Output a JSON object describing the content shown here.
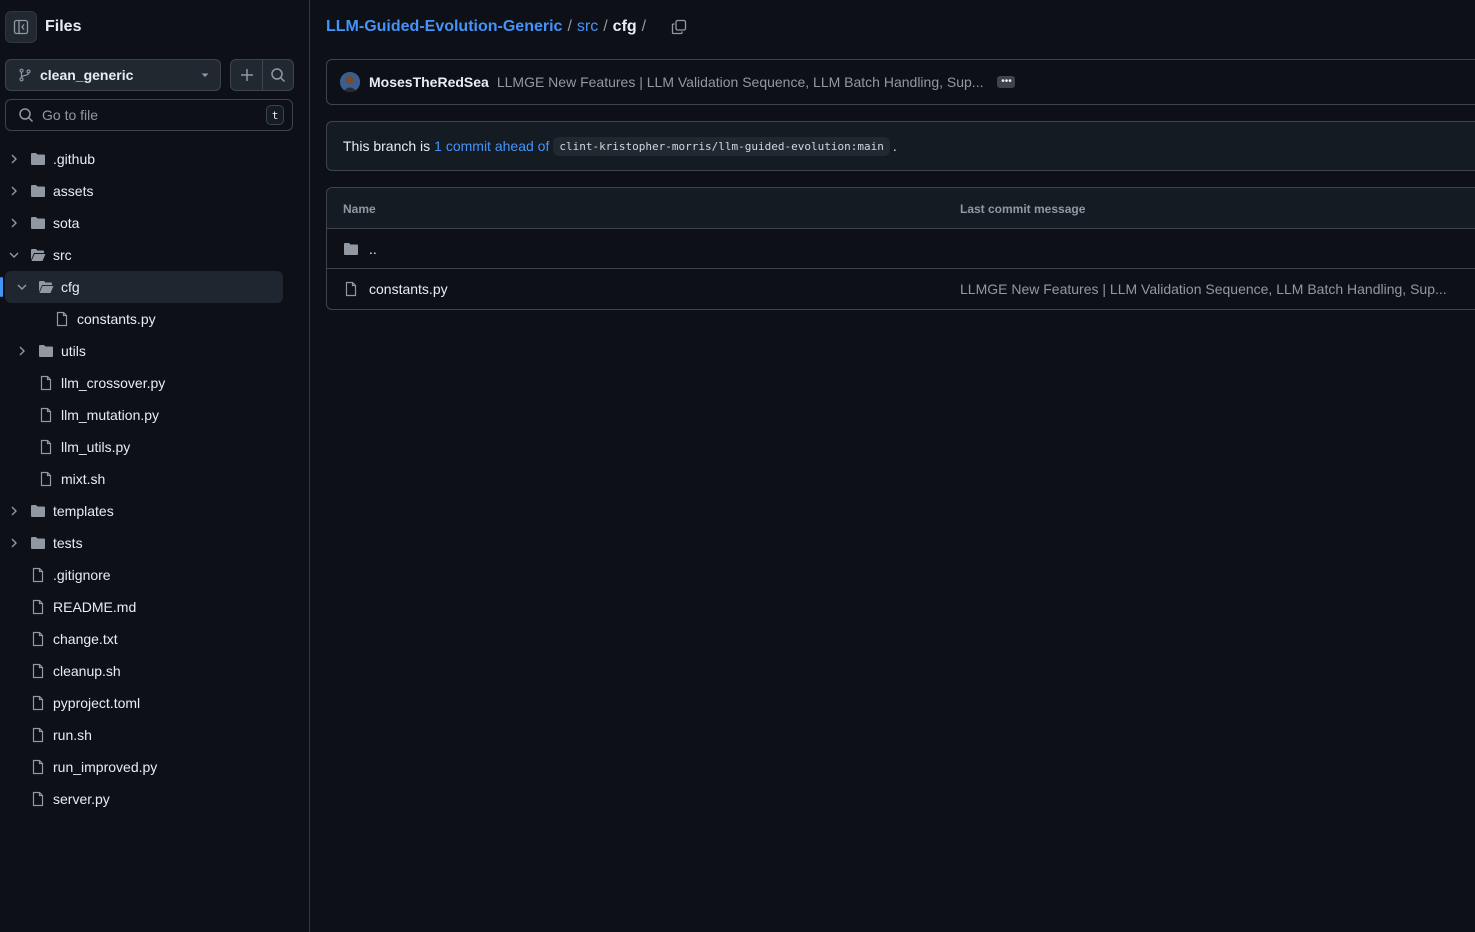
{
  "sidebar": {
    "title": "Files",
    "branch": "clean_generic",
    "search_placeholder": "Go to file",
    "search_shortcut": "t",
    "tree": [
      {
        "label": ".github",
        "type": "folder",
        "depth": 0,
        "expanded": false
      },
      {
        "label": "assets",
        "type": "folder",
        "depth": 0,
        "expanded": false
      },
      {
        "label": "sota",
        "type": "folder",
        "depth": 0,
        "expanded": false
      },
      {
        "label": "src",
        "type": "folder-open",
        "depth": 0,
        "expanded": true
      },
      {
        "label": "cfg",
        "type": "folder-open",
        "depth": 1,
        "expanded": true,
        "selected": true
      },
      {
        "label": "constants.py",
        "type": "file",
        "depth": 2
      },
      {
        "label": "utils",
        "type": "folder",
        "depth": 1,
        "expanded": false
      },
      {
        "label": "llm_crossover.py",
        "type": "file",
        "depth": 1
      },
      {
        "label": "llm_mutation.py",
        "type": "file",
        "depth": 1
      },
      {
        "label": "llm_utils.py",
        "type": "file",
        "depth": 1
      },
      {
        "label": "mixt.sh",
        "type": "file",
        "depth": 1
      },
      {
        "label": "templates",
        "type": "folder",
        "depth": 0,
        "expanded": false
      },
      {
        "label": "tests",
        "type": "folder",
        "depth": 0,
        "expanded": false
      },
      {
        "label": ".gitignore",
        "type": "file",
        "depth": 0
      },
      {
        "label": "README.md",
        "type": "file",
        "depth": 0
      },
      {
        "label": "change.txt",
        "type": "file",
        "depth": 0
      },
      {
        "label": "cleanup.sh",
        "type": "file",
        "depth": 0
      },
      {
        "label": "pyproject.toml",
        "type": "file",
        "depth": 0
      },
      {
        "label": "run.sh",
        "type": "file",
        "depth": 0
      },
      {
        "label": "run_improved.py",
        "type": "file",
        "depth": 0
      },
      {
        "label": "server.py",
        "type": "file",
        "depth": 0
      }
    ]
  },
  "breadcrumb": {
    "repo": "LLM-Guided-Evolution-Generic",
    "src": "src",
    "current": "cfg",
    "sep": "/"
  },
  "commit": {
    "author": "MosesTheRedSea",
    "message": "LLMGE New Features | LLM Validation Sequence, LLM Batch Handling, Sup...",
    "ellipsis": "•••"
  },
  "branch_status": {
    "prefix": "This branch is",
    "link": "1 commit ahead of",
    "ref": "clint-kristopher-morris/llm-guided-evolution:main",
    "suffix": "."
  },
  "table": {
    "col_name": "Name",
    "col_msg": "Last commit message",
    "rows": [
      {
        "name": "..",
        "type": "folder",
        "message": ""
      },
      {
        "name": "constants.py",
        "type": "file",
        "message": "LLMGE New Features | LLM Validation Sequence, LLM Batch Handling, Sup..."
      }
    ]
  },
  "colors": {
    "background": "#0d1117",
    "accent": "#4493f8",
    "border": "#3d444d",
    "muted": "#9198a1"
  }
}
